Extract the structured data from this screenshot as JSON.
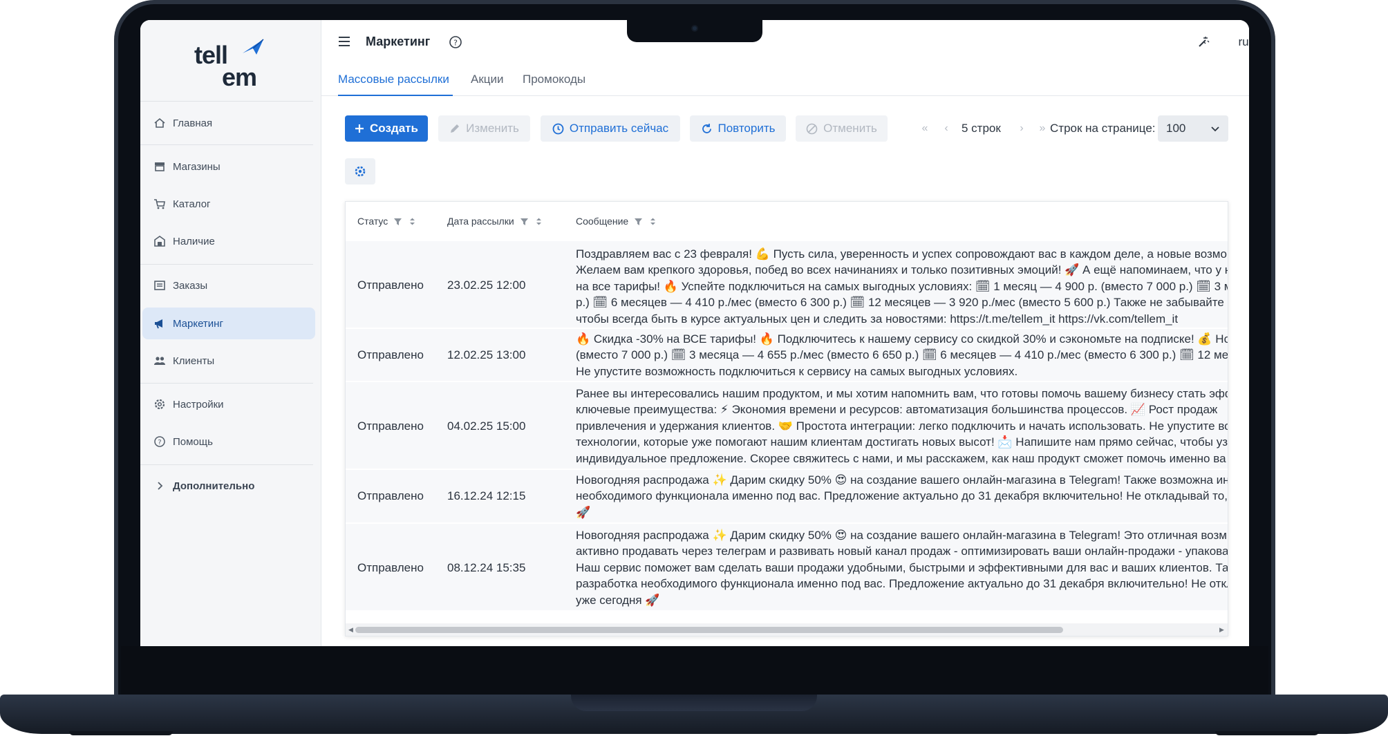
{
  "app": {
    "logo_line1": "tell",
    "logo_line2": "em",
    "colors": {
      "accent": "#1f6fd6",
      "sidebar_bg": "#f5f6f8",
      "active_nav_bg": "#dde8f7"
    }
  },
  "sidebar": {
    "items": [
      {
        "label": "Главная",
        "icon": "home-icon"
      },
      {
        "label": "Магазины",
        "icon": "store-icon"
      },
      {
        "label": "Каталог",
        "icon": "cart-icon"
      },
      {
        "label": "Наличие",
        "icon": "warehouse-icon"
      },
      {
        "label": "Заказы",
        "icon": "orders-icon"
      },
      {
        "label": "Маркетинг",
        "icon": "megaphone-icon"
      },
      {
        "label": "Клиенты",
        "icon": "users-icon"
      },
      {
        "label": "Настройки",
        "icon": "gear-icon"
      },
      {
        "label": "Помощь",
        "icon": "help-icon"
      }
    ],
    "extra_label": "Дополнительно"
  },
  "header": {
    "title": "Маркетинг",
    "lang": "ru"
  },
  "tabs": [
    {
      "label": "Массовые рассылки"
    },
    {
      "label": "Акции"
    },
    {
      "label": "Промокоды"
    }
  ],
  "toolbar": {
    "create": "Создать",
    "edit": "Изменить",
    "send_now": "Отправить сейчас",
    "repeat": "Повторить",
    "cancel": "Отменить",
    "rows_count": "5 строк",
    "rows_per_page_label": "Строк на странице:",
    "rows_per_page_value": "100"
  },
  "table": {
    "columns": [
      "Статус",
      "Дата рассылки",
      "Сообщение"
    ],
    "rows": [
      {
        "status": "Отправлено",
        "date": "23.02.25 12:00",
        "lines": [
          "Поздравляем вас с 23 февраля! 💪 Пусть сила, уверенность и успех сопровождают вас в каждом деле, а новые возмо",
          "Желаем вам крепкого здоровья, побед во всех начинаниях и только позитивных эмоций! 🚀 А ещё напоминаем, что у н",
          "на все тарифы! 🔥 Успейте подключиться на самых выгодных условиях: 🗓 1 месяц — 4 900 р. (вместо 7 000 р.) 🗓 3 м",
          "р.) 🗓 6 месяцев — 4 410 р./мес (вместо 6 300 р.) 🗓 12 месяцев — 3 920 р./мес (вместо 5 600 р.) Также не забывайте по",
          "чтобы всегда быть в курсе актуальных цен и следить за новостями: https://t.me/tellem_it https://vk.com/tellem_it"
        ]
      },
      {
        "status": "Отправлено",
        "date": "12.02.25 13:00",
        "lines": [
          "🔥 Скидка -30% на ВСЕ тарифы! 🔥 Подключитесь к нашему сервису со скидкой 30% и сэкономьте на подписке! 💰 Нов",
          "(вместо 7 000 р.) 🗓 3 месяца — 4 655 р./мес (вместо 6 650 р.) 🗓 6 месяцев — 4 410 р./мес (вместо 6 300 р.) 🗓 12 меся",
          "Не упустите возможность подключиться к сервису на самых выгодных условиях."
        ]
      },
      {
        "status": "Отправлено",
        "date": "04.02.25 15:00",
        "lines": [
          "Ранее вы интересовались нашим продуктом, и мы хотим напомнить вам, что готовы помочь вашему бизнесу стать эфф",
          "ключевые преимущества: ⚡ Экономия времени и ресурсов: автоматизация большинства процессов. 📈 Рост продаж",
          "привлечения и удержания клиентов. 🤝 Простота интеграции: легко подключить и начать использовать. Не упустите во",
          "технологии, которые уже помогают нашим клиентам достигать новых высот! 📩 Напишите нам прямо сейчас, чтобы уз",
          "индивидуальное предложение. Скорее свяжитесь с нами, и мы расскажем, как наш продукт сможет помочь именно ва"
        ]
      },
      {
        "status": "Отправлено",
        "date": "16.12.24 12:15",
        "lines": [
          "Новогодняя распродажа ✨ Дарим скидку 50% 😍 на создание вашего онлайн-магазина в Telegram! Также возможна ин",
          "необходимого функционала именно под вас. Предложение актуально до 31 декабря включительно! Не откладывай то,",
          "🚀"
        ]
      },
      {
        "status": "Отправлено",
        "date": "08.12.24 15:35",
        "lines": [
          "Новогодняя распродажа ✨ Дарим скидку 50% 😍 на создание вашего онлайн-магазина в Telegram! Это отличная возм",
          "активно продавать через телеграм и развивать новый канал продаж - оптимизировать ваши онлайн-продажи - упакова",
          "Наш сервис поможет вам сделать ваши продажи удобными, быстрыми и эффективными для вас и ваших клиентов. Та",
          "разработка необходимого функционала именно под вас. Предложение актуально до 31 декабря включительно! Не откл",
          "уже сегодня 🚀"
        ]
      }
    ]
  }
}
